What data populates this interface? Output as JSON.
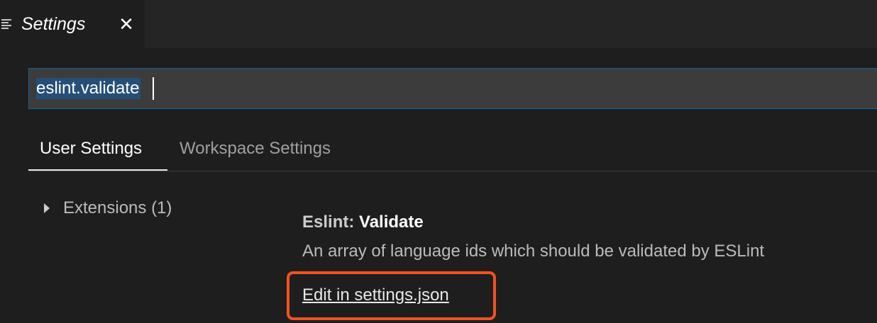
{
  "editor_tab": {
    "title": "Settings",
    "icon": "settings-list-icon",
    "close_glyph": "✕"
  },
  "search": {
    "value": "eslint.validate",
    "selected": true
  },
  "scope_tabs": [
    {
      "label": "User Settings",
      "active": true
    },
    {
      "label": "Workspace Settings",
      "active": false
    }
  ],
  "toc": {
    "items": [
      {
        "label": "Extensions (1)",
        "expanded": false
      }
    ]
  },
  "setting": {
    "category": "Eslint: ",
    "name": "Validate",
    "description": "An array of language ids which should be validated by ESLint",
    "edit_link": "Edit in settings.json"
  },
  "annotation": {
    "highlight_color": "#f4511e"
  },
  "colors": {
    "background": "#1e1e1e",
    "tabbar": "#252526",
    "input_background": "#3c3c3c",
    "focus_border": "#0e639c",
    "selection": "#264f78"
  }
}
